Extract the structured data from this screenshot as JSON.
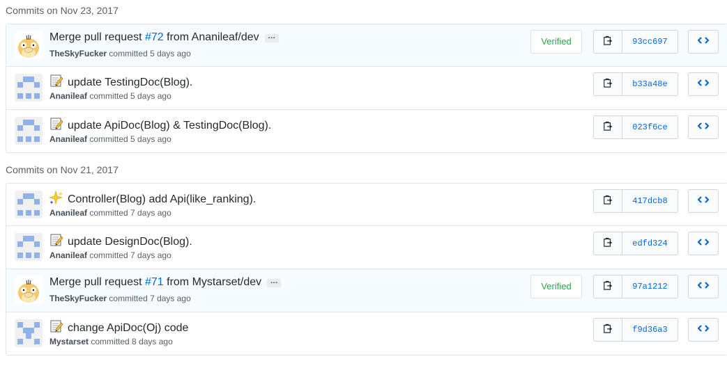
{
  "groups": [
    {
      "header": "Commits on Nov 23, 2017",
      "commits": [
        {
          "pre": "Merge pull request ",
          "pr": "#72",
          "post": " from Ananileaf/dev",
          "emoji": "",
          "author": "TheSkyFucker",
          "committed": "committed 5 days ago",
          "verified": "Verified",
          "sha": "93cc697",
          "avatar": "psyduck"
        },
        {
          "pre": "update TestingDoc(Blog).",
          "pr": "",
          "post": "",
          "emoji": "memo",
          "author": "Ananileaf",
          "committed": "committed 5 days ago",
          "verified": "",
          "sha": "b33a48e",
          "avatar": "identicon"
        },
        {
          "pre": "update ApiDoc(Blog) & TestingDoc(Blog).",
          "pr": "",
          "post": "",
          "emoji": "memo",
          "author": "Ananileaf",
          "committed": "committed 5 days ago",
          "verified": "",
          "sha": "023f6ce",
          "avatar": "identicon"
        }
      ]
    },
    {
      "header": "Commits on Nov 21, 2017",
      "commits": [
        {
          "pre": "Controller(Blog) add Api(like_ranking).",
          "pr": "",
          "post": "",
          "emoji": "sparkles",
          "author": "Ananileaf",
          "committed": "committed 7 days ago",
          "verified": "",
          "sha": "417dcb8",
          "avatar": "identicon"
        },
        {
          "pre": "update DesignDoc(Blog).",
          "pr": "",
          "post": "",
          "emoji": "memo",
          "author": "Ananileaf",
          "committed": "committed 7 days ago",
          "verified": "",
          "sha": "edfd324",
          "avatar": "identicon"
        },
        {
          "pre": "Merge pull request ",
          "pr": "#71",
          "post": " from Mystarset/dev",
          "emoji": "",
          "author": "TheSkyFucker",
          "committed": "committed 7 days ago",
          "verified": "Verified",
          "sha": "97a1212",
          "avatar": "psyduck"
        },
        {
          "pre": "change ApiDoc(Oj) code",
          "pr": "",
          "post": "",
          "emoji": "memo",
          "author": "Mystarset",
          "committed": "committed 8 days ago",
          "verified": "",
          "sha": "f9d36a3",
          "avatar": "identicon2"
        }
      ]
    }
  ],
  "ellipsis_label": "…",
  "colors": {
    "link": "#0366d6",
    "verified": "#28a745",
    "identicon": "#8fb3e6",
    "psyduck": "#f4c96b"
  }
}
